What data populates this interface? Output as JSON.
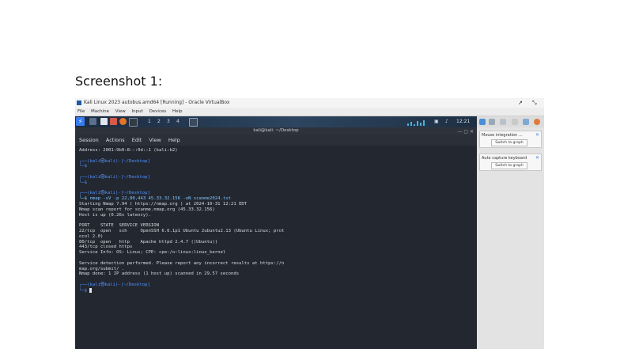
{
  "caption": "Screenshot 1:",
  "vb": {
    "title": "Kali Linux 2023 autobus.amd64 [Running] - Oracle VirtualBox",
    "ctrl_pin": "↗",
    "ctrl_resize": "⤡",
    "menu": [
      "File",
      "Machine",
      "View",
      "Input",
      "Devices",
      "Help"
    ]
  },
  "kali_panel": {
    "workspaces": [
      "1",
      "2",
      "3",
      "4"
    ],
    "tray_time": "12:21"
  },
  "terminal": {
    "title": "kali@kali: ~/Desktop",
    "menu": [
      "Session",
      "Actions",
      "Edit",
      "View",
      "Help"
    ],
    "lines": [
      {
        "t": "Address: 2001:9b0:8:::0d::1 (kali:b2)",
        "c": ""
      },
      {
        "t": "",
        "c": ""
      },
      {
        "t": "┌──(kali㉿kali)-[~/Desktop]",
        "c": "blue"
      },
      {
        "t": "└─$",
        "c": "blue"
      },
      {
        "t": "",
        "c": ""
      },
      {
        "t": "┌──(kali㉿kali)-[~/Desktop]",
        "c": "blue"
      },
      {
        "t": "└─$",
        "c": "blue"
      },
      {
        "t": "",
        "c": ""
      },
      {
        "t": "┌──(kali㉿kali)-[~/Desktop]",
        "c": "blue"
      },
      {
        "t": "└─$ nmap -sV -p 22,80,443 45.33.32.156 -oN scanme2024.txt",
        "c": "cyan"
      },
      {
        "t": "Starting Nmap 7.94 ( https://nmap.org ) at 2024-10-31 12:21 EDT",
        "c": ""
      },
      {
        "t": "Nmap scan report for scanme.nmap.org (45.33.32.156)",
        "c": ""
      },
      {
        "t": "Host is up (0.26s latency).",
        "c": ""
      },
      {
        "t": "",
        "c": ""
      },
      {
        "t": "PORT    STATE  SERVICE VERSION",
        "c": ""
      },
      {
        "t": "22/tcp  open   ssh     OpenSSH 6.6.1p1 Ubuntu 2ubuntu2.13 (Ubuntu Linux; prot",
        "c": ""
      },
      {
        "t": "ocol 2.0)",
        "c": ""
      },
      {
        "t": "80/tcp  open   http    Apache httpd 2.4.7 ((Ubuntu))",
        "c": ""
      },
      {
        "t": "443/tcp closed https",
        "c": ""
      },
      {
        "t": "Service Info: OS: Linux; CPE: cpe:/o:linux:linux_kernel",
        "c": ""
      },
      {
        "t": "",
        "c": ""
      },
      {
        "t": "Service detection performed. Please report any incorrect results at https://n",
        "c": ""
      },
      {
        "t": "map.org/submit/ .",
        "c": ""
      },
      {
        "t": "Nmap done: 1 IP address (1 host up) scanned in 29.57 seconds",
        "c": ""
      },
      {
        "t": "",
        "c": ""
      },
      {
        "t": "┌──(kali㉿kali)-[~/Desktop]",
        "c": "blue"
      },
      {
        "t": "└─$ ",
        "c": "blue"
      }
    ]
  },
  "side_panel": {
    "cards": [
      {
        "title": "Mouse integration ...",
        "button": "Switch to graph"
      },
      {
        "title": "Auto capture keyboard",
        "button": "Switch to graph"
      }
    ]
  },
  "colors": {
    "kali_blue": "#367bf0",
    "terminal_bg": "#232730",
    "prompt_blue": "#4f93ff"
  }
}
